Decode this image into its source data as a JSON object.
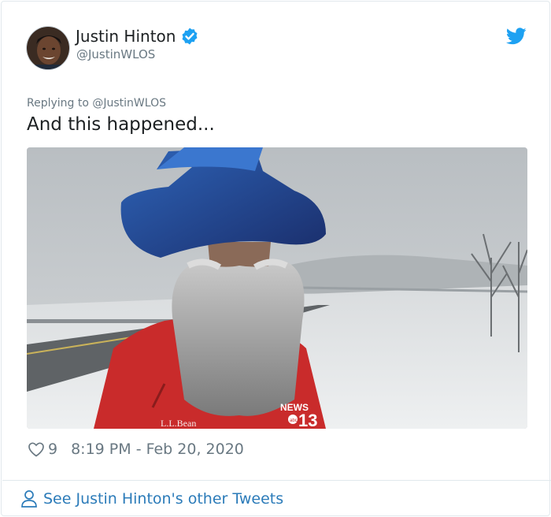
{
  "tweet": {
    "author": {
      "name": "Justin Hinton",
      "handle": "@JustinWLOS",
      "verified": true
    },
    "reply_to": "Replying to @JustinWLOS",
    "text": "And this happened...",
    "media_overlay": {
      "logo_text": "NEWS",
      "channel_number": "13",
      "network_badge": "abc",
      "jacket_brand": "L.L.Bean"
    },
    "likes": "9",
    "timestamp": "8:19 PM - Feb 20, 2020",
    "footer_link": "See Justin Hinton's other Tweets"
  },
  "icons": {
    "verified": "verified-badge-icon",
    "bird": "twitter-bird-icon",
    "like": "heart-icon",
    "person": "person-icon"
  },
  "colors": {
    "twitter_blue": "#1da1f2",
    "link_blue": "#2b7bb9",
    "muted_gray": "#697882",
    "text_dark": "#1c2022"
  }
}
